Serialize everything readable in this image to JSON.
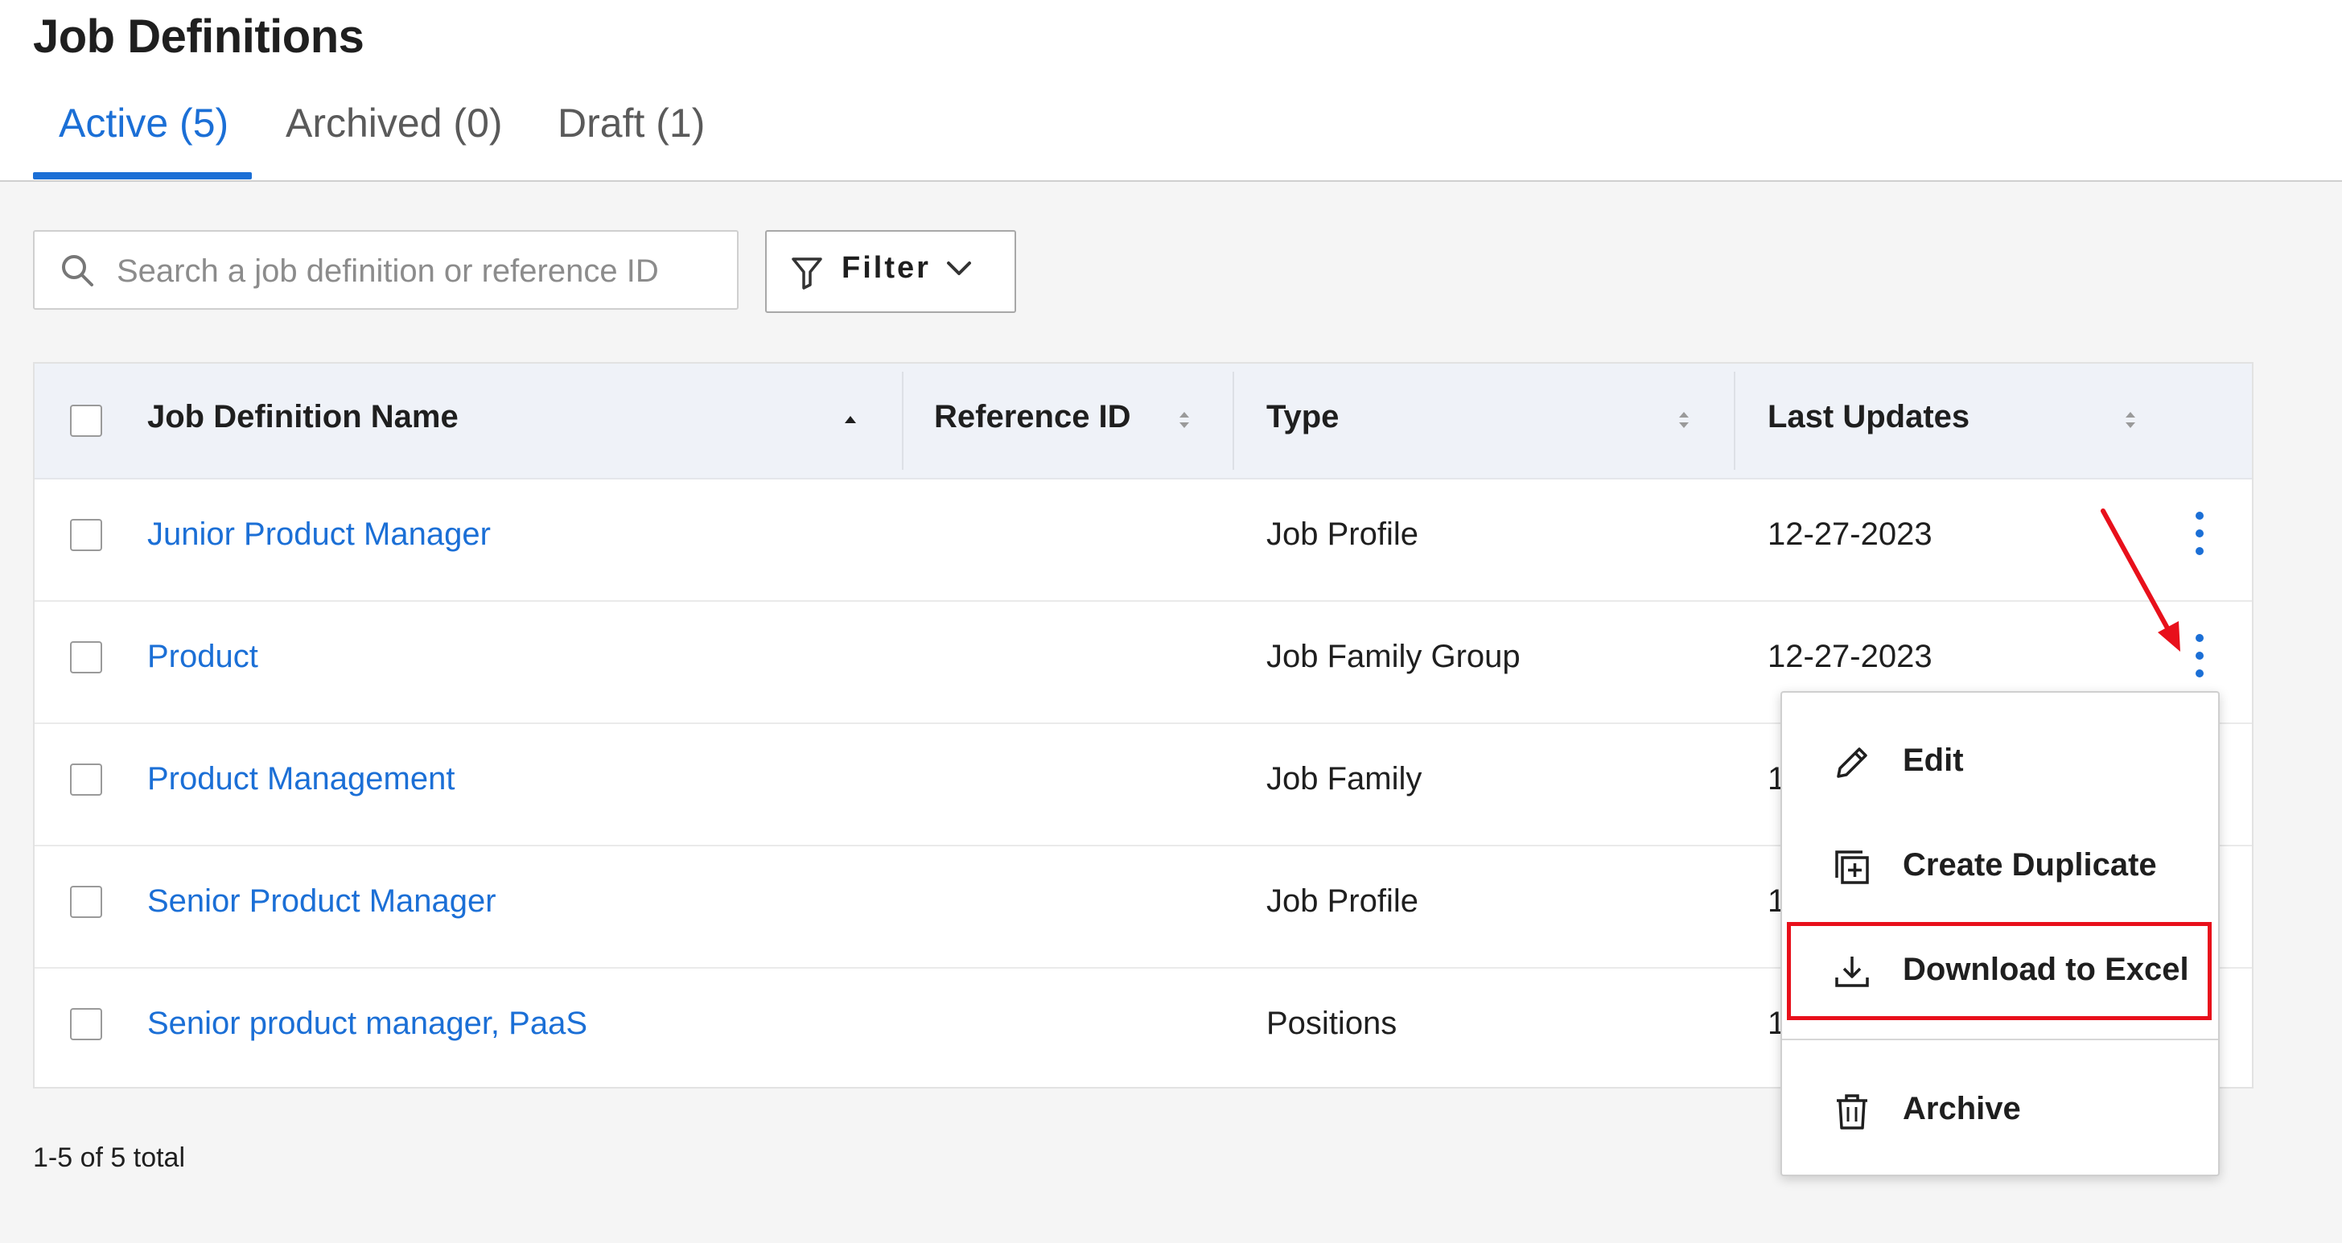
{
  "page": {
    "title": "Job Definitions"
  },
  "tabs": [
    {
      "label": "Active (5)",
      "active": true
    },
    {
      "label": "Archived (0)",
      "active": false
    },
    {
      "label": "Draft (1)",
      "active": false
    }
  ],
  "search": {
    "placeholder": "Search a job definition or reference ID",
    "value": ""
  },
  "filter": {
    "label": "Filter"
  },
  "table": {
    "columns": [
      "Job Definition Name",
      "Reference ID",
      "Type",
      "Last Updates"
    ],
    "rows": [
      {
        "name": "Junior Product Manager",
        "reference_id": "",
        "type": "Job Profile",
        "last_updated": "12-27-2023"
      },
      {
        "name": "Product",
        "reference_id": "",
        "type": "Job Family Group",
        "last_updated": "12-27-2023"
      },
      {
        "name": "Product Management",
        "reference_id": "",
        "type": "Job Family",
        "last_updated": "1"
      },
      {
        "name": "Senior Product Manager",
        "reference_id": "",
        "type": "Job Profile",
        "last_updated": "1"
      },
      {
        "name": "Senior product manager, PaaS",
        "reference_id": "",
        "type": "Positions",
        "last_updated": "1"
      }
    ]
  },
  "pagination": {
    "summary": "1-5 of 5 total"
  },
  "context_menu": {
    "items": [
      {
        "label": "Edit",
        "icon": "pencil-icon"
      },
      {
        "label": "Create Duplicate",
        "icon": "duplicate-icon"
      },
      {
        "label": "Download to Excel",
        "icon": "download-icon",
        "highlighted": true
      },
      {
        "label": "Archive",
        "icon": "trash-icon"
      }
    ]
  },
  "colors": {
    "accent": "#1b6fd6",
    "annotation": "#e8101b",
    "header_bg": "#eff2f8",
    "page_bg": "#f5f5f5"
  }
}
